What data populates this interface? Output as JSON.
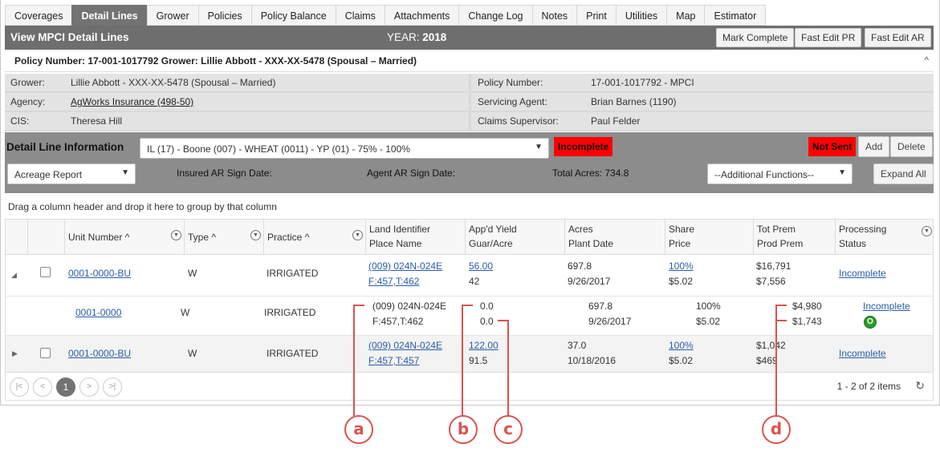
{
  "tabs": [
    "Coverages",
    "Detail Lines",
    "Grower",
    "Policies",
    "Policy Balance",
    "Claims",
    "Attachments",
    "Change Log",
    "Notes",
    "Print",
    "Utilities",
    "Map",
    "Estimator"
  ],
  "active_tab": "Detail Lines",
  "titlebar": {
    "title": "View MPCI Detail Lines",
    "year_label": "YEAR:",
    "year_value": "2018",
    "buttons": [
      "Mark Complete",
      "Fast Edit PR",
      "Fast Edit AR"
    ]
  },
  "policy_line": {
    "text": "Policy Number: 17-001-1017792 Grower: Lillie Abbott - XXX-XX-5478 (Spousal – Married)",
    "collapse": "^"
  },
  "info": {
    "grower_label": "Grower:",
    "grower_value": "Lillie Abbott - XXX-XX-5478 (Spousal – Married)",
    "policy_number_label": "Policy Number:",
    "policy_number_value": "17-001-1017792 - MPCI",
    "agency_label": "Agency:",
    "agency_value": "AgWorks Insurance (498-50)",
    "servicing_agent_label": "Servicing Agent:",
    "servicing_agent_value": "Brian Barnes (1190)",
    "cis_label": "CIS:",
    "cis_value": "Theresa Hill",
    "claims_supervisor_label": "Claims Supervisor:",
    "claims_supervisor_value": "Paul Felder"
  },
  "detail_line": {
    "heading": "Detail Line Information",
    "selected_line": "IL (17) - Boone (007) - WHEAT (0011) - YP (01) - 75% - 100%",
    "status": "Incomplete",
    "send_status": "Not Sent",
    "add_label": "Add",
    "delete_label": "Delete",
    "report_select": "Acreage Report",
    "insured_ar_sign_date_label": "Insured AR Sign Date:",
    "agent_ar_sign_date_label": "Agent AR Sign Date:",
    "total_acres": "Total Acres: 734.8",
    "additional_functions": "--Additional Functions--",
    "expand_all": "Expand All"
  },
  "group_hint": "Drag a column header and drop it here to group by that column",
  "columns": {
    "unit_number": "Unit Number",
    "type": "Type",
    "practice": "Practice",
    "land_identifier": "Land Identifier",
    "place_name": "Place Name",
    "appd_yield": "App'd Yield",
    "guar_acre": "Guar/Acre",
    "acres": "Acres",
    "plant_date": "Plant Date",
    "share": "Share",
    "price": "Price",
    "tot_prem": "Tot Prem",
    "prod_prem": "Prod Prem",
    "processing": "Processing",
    "status": "Status"
  },
  "rows": [
    {
      "unit": "0001-0000-BU",
      "type": "W",
      "practice": "IRRIGATED",
      "land_id": "(009) 024N-024E",
      "place": "F:457,T:462",
      "yield": "56.00",
      "guar": "42",
      "acres": "697.8",
      "plant_date": "9/26/2017",
      "share": "100%",
      "price": "$5.02",
      "tot_prem": "$16,791",
      "prod_prem": "$7,556",
      "status": "Incomplete"
    },
    {
      "unit": "0001-0000",
      "type": "W",
      "practice": "IRRIGATED",
      "land_id": "(009) 024N-024E",
      "place": "F:457,T:462",
      "yield": "0.0",
      "guar": "0.0",
      "acres": "697.8",
      "plant_date": "9/26/2017",
      "share": "100%",
      "price": "$5.02",
      "tot_prem": "$4,980",
      "prod_prem": "$1,743",
      "status": "Incomplete",
      "status_icon": "O"
    },
    {
      "unit": "0001-0000-BU",
      "type": "W",
      "practice": "IRRIGATED",
      "land_id": "(009) 024N-024E",
      "place": "F:457,T:457",
      "yield": "122.00",
      "guar": "91.5",
      "acres": "37.0",
      "plant_date": "10/18/2016",
      "share": "100%",
      "price": "$5.02",
      "tot_prem": "$1,042",
      "prod_prem": "$469",
      "status": "Incomplete"
    }
  ],
  "pager": {
    "current_page": "1",
    "summary": "1 - 2 of 2 items"
  },
  "callouts": [
    "a",
    "b",
    "c",
    "d"
  ],
  "colors": {
    "accent_red": "#ff0000",
    "header_gray": "#6e6e6e",
    "link_blue": "#2a5da8",
    "callout": "#d9534f"
  }
}
